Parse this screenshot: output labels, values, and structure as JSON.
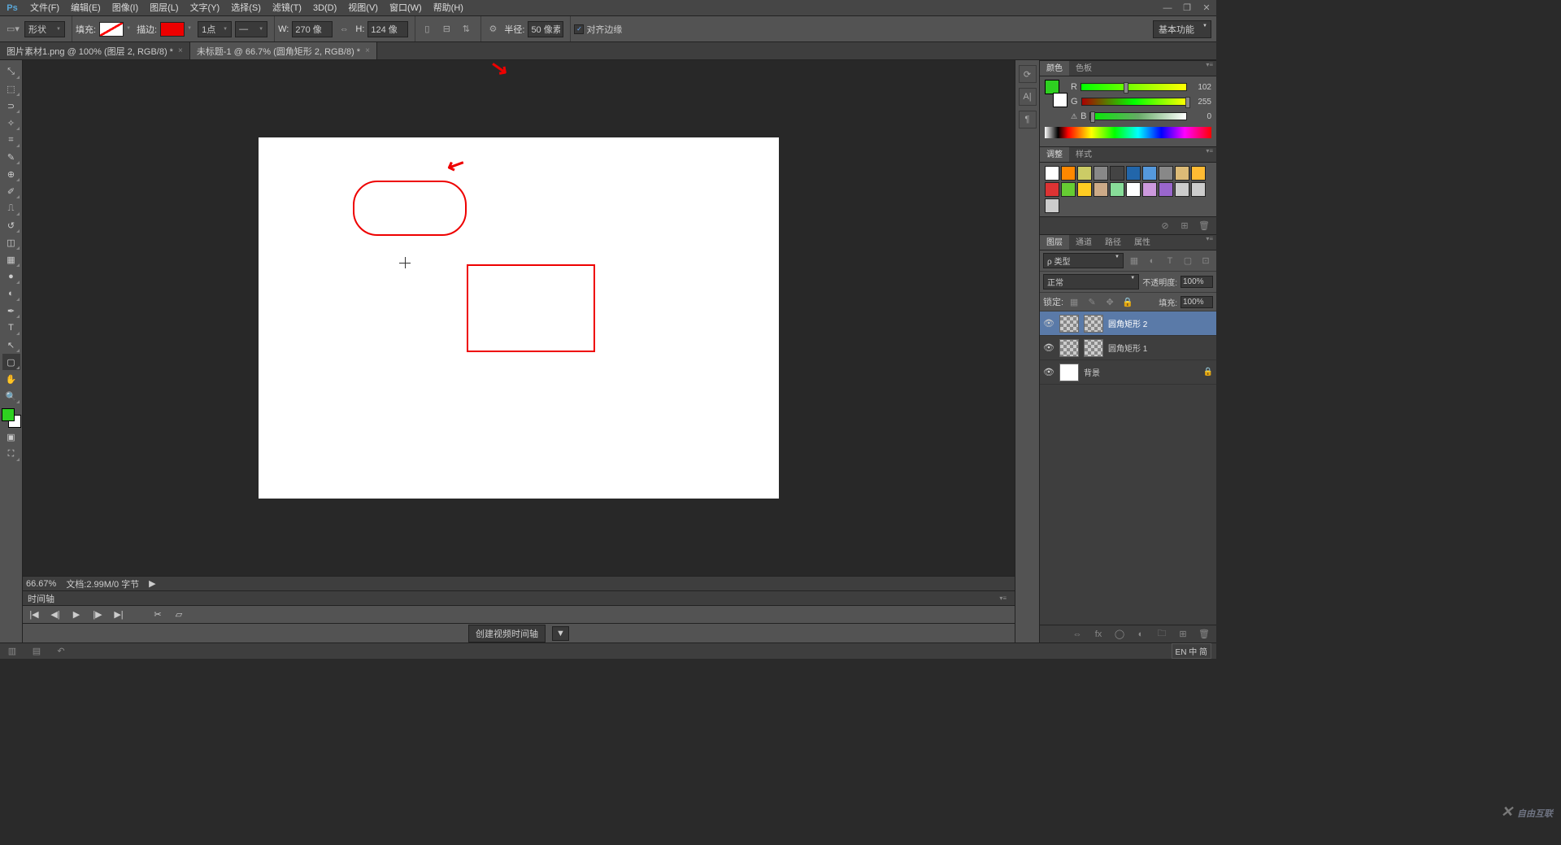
{
  "menubar": {
    "items": [
      "文件(F)",
      "编辑(E)",
      "图像(I)",
      "图层(L)",
      "文字(Y)",
      "选择(S)",
      "滤镜(T)",
      "3D(D)",
      "视图(V)",
      "窗口(W)",
      "帮助(H)"
    ]
  },
  "optionsbar": {
    "mode": "形状",
    "fill_label": "填充:",
    "stroke_label": "描边:",
    "stroke_width": "1点",
    "w_label": "W:",
    "w_value": "270 像",
    "h_label": "H:",
    "h_value": "124 像",
    "radius_label": "半径:",
    "radius_value": "50 像素",
    "align_edges": "对齐边缘",
    "workspace": "基本功能"
  },
  "tabs": [
    {
      "label": "图片素材1.png @ 100% (图层 2, RGB/8) *"
    },
    {
      "label": "未标题-1 @ 66.7% (圆角矩形 2, RGB/8) *"
    }
  ],
  "canvas": {
    "zoom": "66.67%",
    "docsize": "文档:2.99M/0 字节"
  },
  "timeline": {
    "title": "时间轴",
    "create_btn": "创建视频时间轴"
  },
  "panels": {
    "color": {
      "tab1": "颜色",
      "tab2": "色板",
      "r": 102,
      "g": 255,
      "b": 0
    },
    "adjust": {
      "tab1": "调整",
      "tab2": "样式"
    },
    "layers": {
      "tab1": "图层",
      "tab2": "通道",
      "tab3": "路径",
      "tab4": "属性",
      "kind": "ρ 类型",
      "blend": "正常",
      "opacity_label": "不透明度:",
      "opacity": "100%",
      "lock_label": "锁定:",
      "fill_label": "填充:",
      "fill": "100%",
      "items": [
        {
          "name": "圆角矩形 2",
          "selected": true,
          "type": "shape"
        },
        {
          "name": "圆角矩形 1",
          "selected": false,
          "type": "shape"
        },
        {
          "name": "背景",
          "selected": false,
          "type": "bg",
          "locked": true
        }
      ]
    }
  },
  "ime": "EN 中 简",
  "colors": {
    "fg": "#2ed020",
    "stroke": "#e00000"
  },
  "swatches": [
    "#ffffff",
    "#ff8800",
    "#cccc66",
    "#888888",
    "#444444",
    "#2266aa",
    "#5599dd",
    "#888888",
    "#ddbb77",
    "#ffbb33",
    "#dd3333",
    "#66cc33",
    "#ffcc22",
    "#ccaa88",
    "#88dd99",
    "#ffffff",
    "#cc99dd",
    "#9966cc",
    "#cccccc",
    "#cccccc",
    "#cccccc"
  ]
}
